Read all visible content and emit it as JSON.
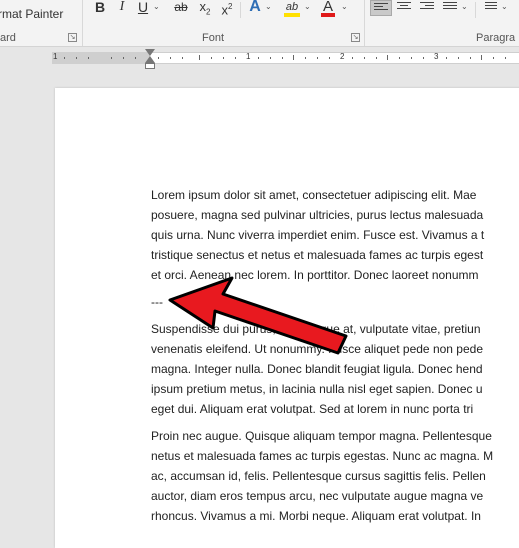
{
  "ribbon": {
    "clipboard": {
      "format_painter": "rmat Painter",
      "group_label": "ard"
    },
    "font": {
      "group_label": "Font"
    },
    "paragraph": {
      "group_label": "Paragra"
    },
    "buttons": {
      "bold": "B",
      "italic": "I",
      "underline": "U",
      "strikethrough": "ab",
      "subscript": "x",
      "superscript": "x",
      "text_effects": "A",
      "highlight": "ab",
      "font_color": "A"
    },
    "colors": {
      "highlight": "#ffe000",
      "font_color": "#e01919",
      "text_effects": "#2f6eb5"
    }
  },
  "ruler": {
    "numbers": [
      "1",
      "1",
      "2",
      "3"
    ]
  },
  "document": {
    "paragraphs": [
      {
        "lines": [
          "Lorem ipsum dolor sit amet, consectetuer adipiscing elit. Mae",
          "posuere, magna sed pulvinar ultricies, purus lectus malesuada",
          "quis urna. Nunc viverra imperdiet enim. Fusce est. Vivamus a t",
          "tristique senectus et netus et malesuada fames ac turpis egest",
          "et orci. Aenean nec lorem. In porttitor. Donec laoreet nonumm"
        ]
      },
      {
        "lines": [
          "---"
        ]
      },
      {
        "lines": [
          "Suspendisse dui purus, scelerisque at, vulputate vitae, pretiun",
          "venenatis eleifend. Ut nonummy. Fusce aliquet pede non pede",
          "magna. Integer nulla. Donec blandit feugiat ligula. Donec hend",
          "ipsum pretium metus, in lacinia nulla nisl eget sapien. Donec u",
          "eget dui. Aliquam erat volutpat. Sed at lorem in nunc porta tri"
        ]
      },
      {
        "lines": [
          "Proin nec augue. Quisque aliquam tempor magna. Pellentesque",
          "netus et malesuada fames ac turpis egestas. Nunc ac magna. M",
          "ac, accumsan id, felis. Pellentesque cursus sagittis felis. Pellen",
          "auctor, diam eros tempus arcu, nec vulputate augue magna ve",
          "rhoncus. Vivamus a mi. Morbi neque. Aliquam erat volutpat. In"
        ]
      }
    ]
  },
  "annotation": {
    "arrow_color": "#e8191f",
    "points_to": "dashes-line"
  }
}
